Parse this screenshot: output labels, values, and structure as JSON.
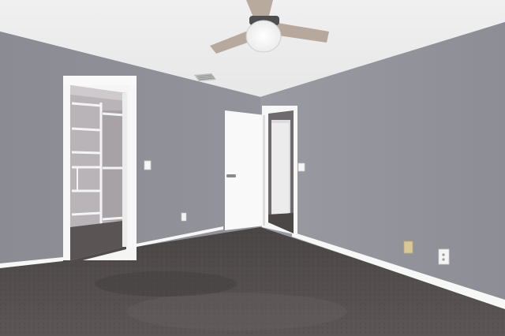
{
  "scene": {
    "kind": "empty-bedroom-interior",
    "colors": {
      "ceiling": "#f2f2f2",
      "left_wall": "#8f8f97",
      "right_wall": "#94949d",
      "back_wall": "#8a8a92",
      "carpet": "#4f4a4a",
      "trim": "#ffffff",
      "closet_interior": "#b9b5b8",
      "ceiling_fan_blade": "#b9aa9e",
      "ceiling_fan_light": "#ffffff"
    },
    "elements": [
      "ceiling-fan-icon",
      "air-vent-icon",
      "walk-in-closet",
      "open-door",
      "hallway-doorway",
      "light-switch-icon",
      "electrical-outlet-icon",
      "cable-outlet-icon",
      "carpet-floor"
    ]
  }
}
